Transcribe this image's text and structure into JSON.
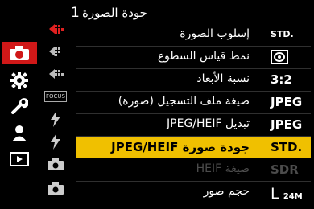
{
  "header": {
    "page_number": "1",
    "title": "جودة الصورة"
  },
  "main_tabs": [
    {
      "name": "photo-tab",
      "active": true
    },
    {
      "name": "gear-tab"
    },
    {
      "name": "wrench-tab"
    },
    {
      "name": "person-tab"
    },
    {
      "name": "playback-tab"
    }
  ],
  "sub_tabs": [
    {
      "text": ""
    },
    {
      "text": ""
    },
    {
      "text": ""
    },
    {
      "text": "FOCUS"
    },
    {
      "text": ""
    },
    {
      "text": ""
    },
    {
      "text": ""
    },
    {
      "text": ""
    }
  ],
  "menu": [
    {
      "label": "إسلوب الصورة",
      "value": "STD."
    },
    {
      "label": "نمط قياس السطوع",
      "value": ""
    },
    {
      "label": "نسبة الأبعاد",
      "value": "3:2"
    },
    {
      "label": "صيغة ملف التسجيل (صورة)",
      "value": "JPEG"
    },
    {
      "label": "تبديل JPEG/HEIF",
      "value": "JPEG"
    },
    {
      "label": "جودة صورة JPEG/HEIF",
      "value": "STD."
    },
    {
      "label": "صيغة HEIF",
      "value": "SDR"
    },
    {
      "label": "حجم صور",
      "value_main": "L",
      "value_sub": "24M"
    }
  ],
  "colors": {
    "accent": "#d01818",
    "highlight": "#f0c000"
  }
}
